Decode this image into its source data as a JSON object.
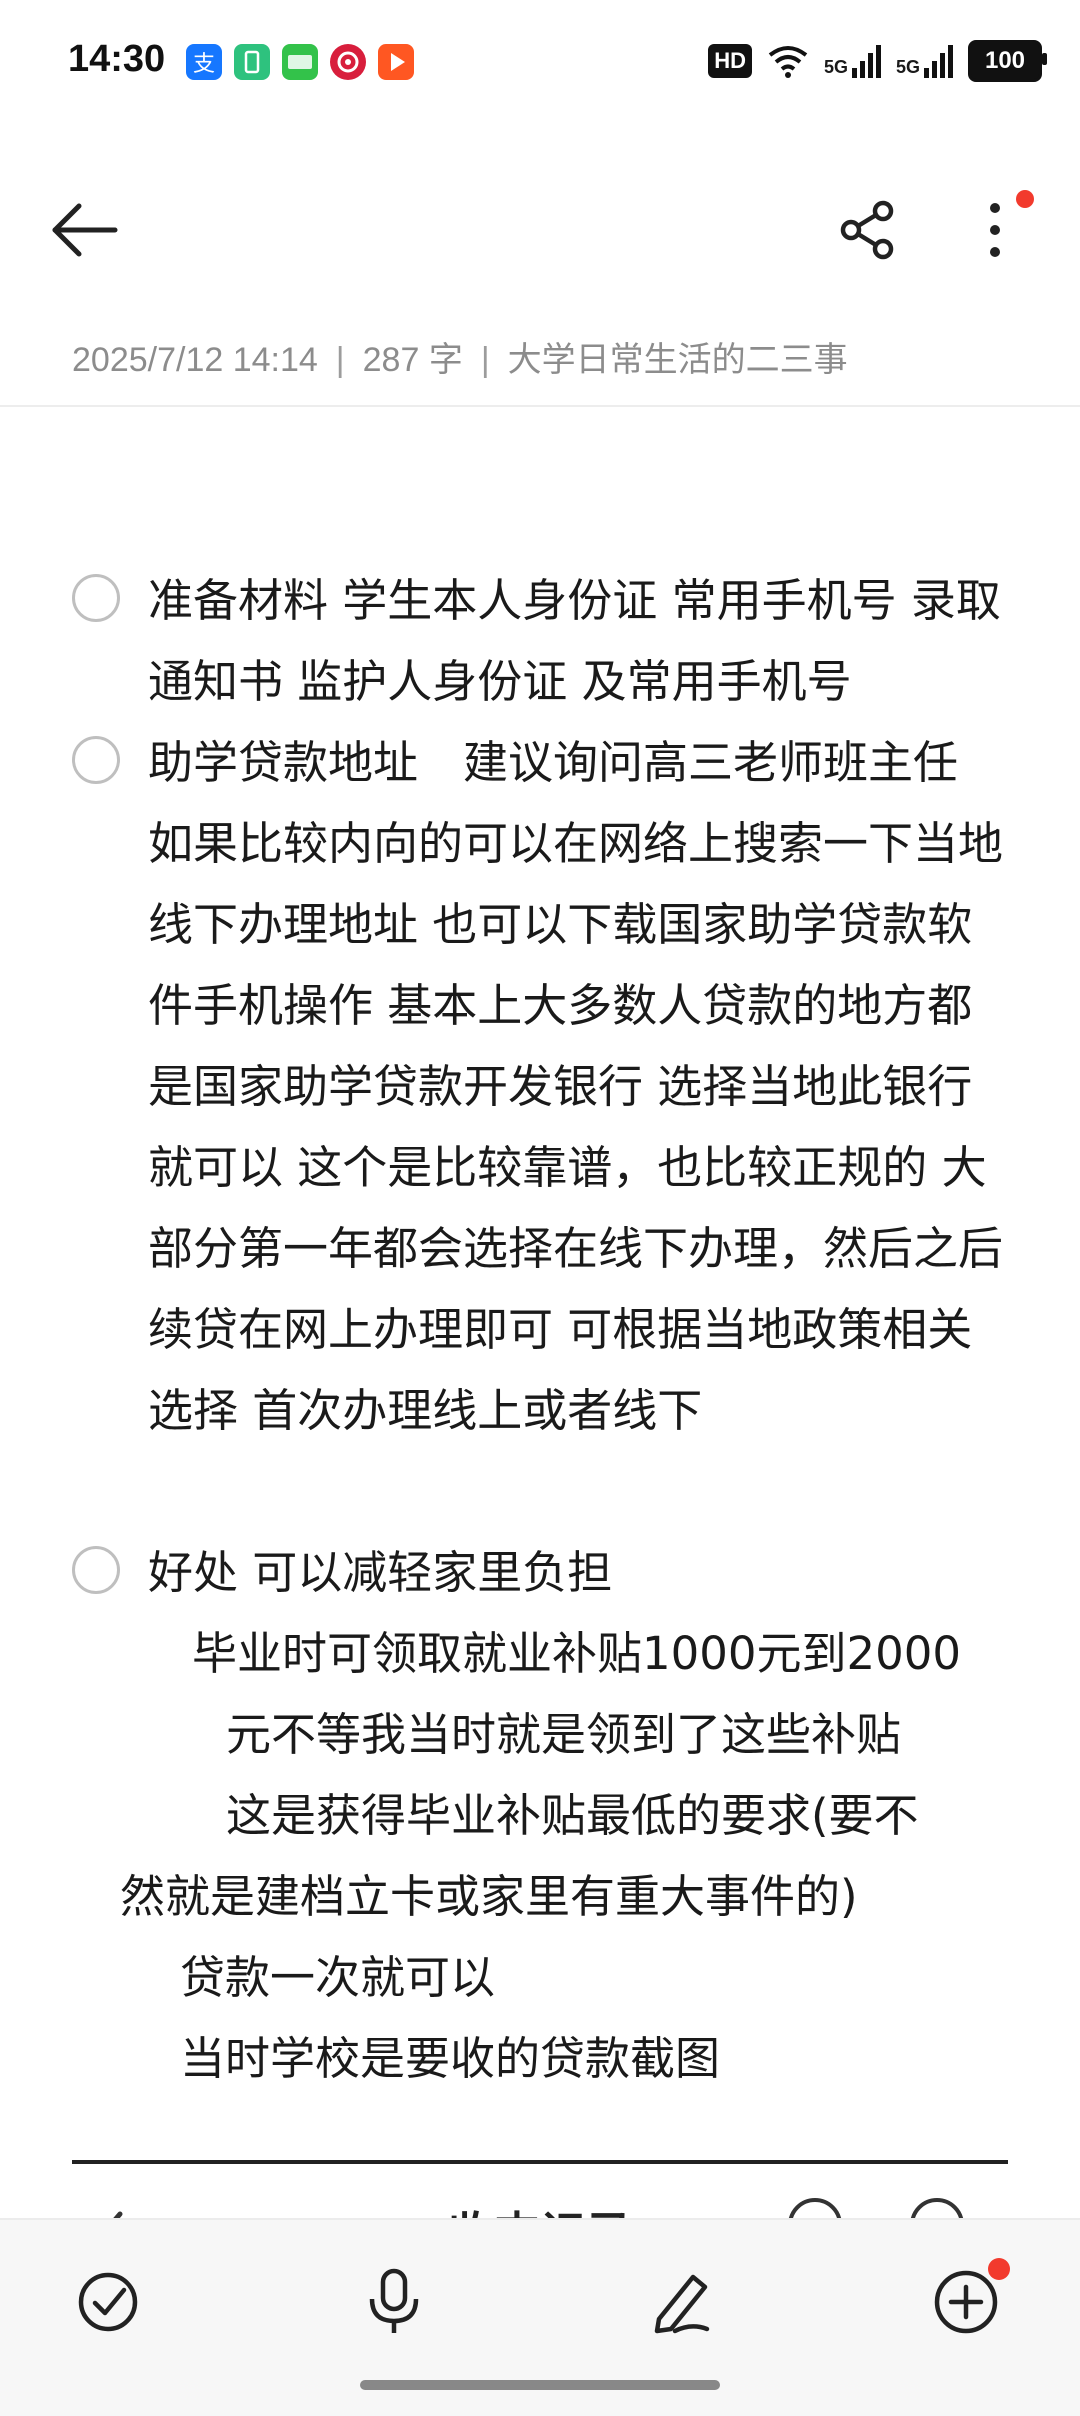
{
  "status_bar": {
    "time": "14:30",
    "hd_label": "HD",
    "network_1": "5G",
    "network_2": "5G",
    "battery": "100",
    "notification_icons": [
      "alipay-icon",
      "battery-app-icon",
      "iqiyi-icon",
      "target-app-icon",
      "video-play-icon"
    ]
  },
  "header": {
    "back_icon": "back-arrow-icon",
    "share_icon": "share-icon",
    "more_icon": "more-vertical-icon"
  },
  "meta": {
    "datetime": "2025/7/12 14:14",
    "word_count": "287 字",
    "folder": "大学日常生活的二三事"
  },
  "content": {
    "todos": [
      {
        "text": "准备材料 学生本人身份证 常用手机号 录取通知书 监护人身份证 及常用手机号",
        "checked": false
      },
      {
        "text": "助学贷款地址　建议询问高三老师班主任 如果比较内向的可以在网络上搜索一下当地线下办理地址 也可以下载国家助学贷款软件手机操作 基本上大多数人贷款的地方都是国家助学贷款开发银行 选择当地此银行就可以  这个是比较靠谱，也比较正规的 大部分第一年都会选择在线下办理，然后之后续贷在网上办理即可 可根据当地政策相关选择 首次办理线上或者线下",
        "checked": false
      },
      {
        "text": "好处 可以减轻家里负担",
        "checked": false
      }
    ],
    "paragraphs": [
      "毕业时可领取就业补贴1000元到2000",
      "元不等我当时就是领到了这些补贴",
      "这是获得毕业补贴最低的要求(要不",
      "然就是建档立卡或家里有重大事件的)",
      "贷款一次就可以",
      "当时学校是要收的贷款截图"
    ],
    "table_title": "收支记录"
  },
  "toolbar": {
    "icons": [
      "checklist-icon",
      "microphone-icon",
      "pen-icon",
      "add-circle-icon"
    ]
  },
  "colors": {
    "accent_red": "#f23a2d",
    "meta_gray": "#8c8c8c"
  }
}
